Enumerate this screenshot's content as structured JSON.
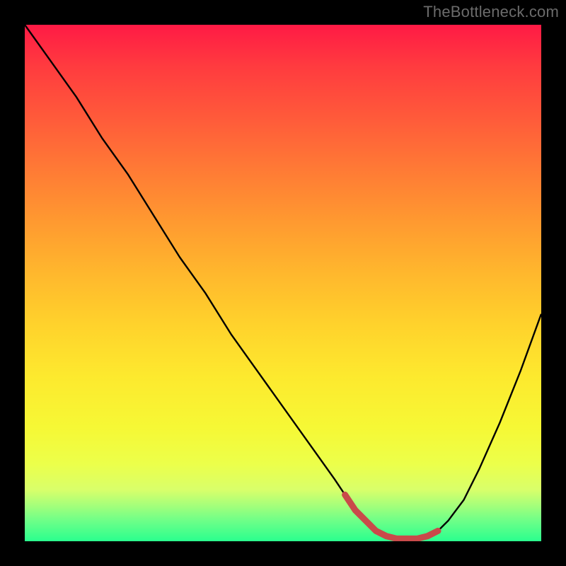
{
  "watermark": "TheBottleneck.com",
  "colors": {
    "background": "#000000",
    "curve": "#000000",
    "marker": "#c94a4a",
    "watermark": "#6b6b6b"
  },
  "chart_data": {
    "type": "line",
    "title": "",
    "xlabel": "",
    "ylabel": "",
    "xlim": [
      0,
      100
    ],
    "ylim": [
      0,
      100
    ],
    "grid": false,
    "series": [
      {
        "name": "bottleneck-curve",
        "x": [
          0,
          5,
          10,
          15,
          20,
          25,
          30,
          35,
          40,
          45,
          50,
          55,
          60,
          62,
          64,
          66,
          68,
          70,
          72,
          74,
          76,
          78,
          80,
          82,
          85,
          88,
          92,
          96,
          100
        ],
        "values": [
          100,
          93,
          86,
          78,
          71,
          63,
          55,
          48,
          40,
          33,
          26,
          19,
          12,
          9,
          6,
          4,
          2,
          1,
          0.5,
          0.5,
          0.5,
          1,
          2,
          4,
          8,
          14,
          23,
          33,
          44
        ]
      }
    ],
    "highlight_segment": {
      "name": "optimal-zone",
      "x": [
        62,
        64,
        66,
        68,
        70,
        72,
        74,
        76,
        78,
        80
      ],
      "values": [
        9,
        6,
        4,
        2,
        1,
        0.5,
        0.5,
        0.5,
        1,
        2
      ]
    }
  }
}
